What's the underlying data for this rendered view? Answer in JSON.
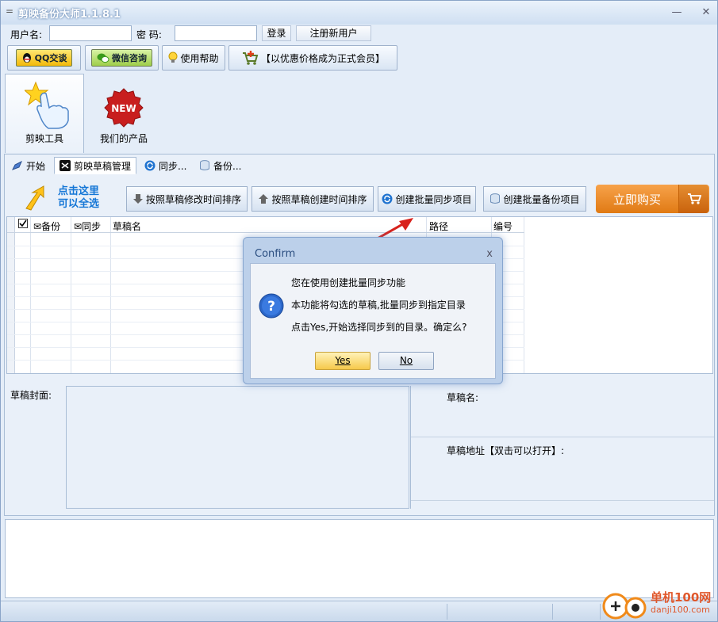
{
  "window": {
    "title": "剪映备份大师1.1.8.1",
    "sysmenu": "=",
    "minimize": "—",
    "close": "✕"
  },
  "login": {
    "username_label": "用户名:",
    "username_value": "",
    "password_label": "密  码:",
    "password_value": "",
    "login_button": "登录",
    "register_button": "注册新用户"
  },
  "toolbar": {
    "qq_label": "QQ交谈",
    "wechat_label": "微信咨询",
    "help_label": "使用帮助",
    "member_label": "【以优惠价格成为正式会员】"
  },
  "bigtabs": [
    {
      "label": "剪映工具",
      "icon": "star-hand-icon",
      "active": true
    },
    {
      "label": "我们的产品",
      "icon": "new-badge-icon",
      "badge": "NEW",
      "active": false
    }
  ],
  "subtabs": [
    {
      "label": "开始",
      "icon": "pen-icon",
      "active": false
    },
    {
      "label": "剪映草稿管理",
      "icon": "capcut-icon",
      "active": true
    },
    {
      "label": "同步...",
      "icon": "sync-icon",
      "active": false
    },
    {
      "label": "备份...",
      "icon": "database-icon",
      "active": false
    }
  ],
  "actions": {
    "select_all_line1": "点击这里",
    "select_all_line2": "可以全选",
    "sort_modified": "按照草稿修改时间排序",
    "sort_created": "按照草稿创建时间排序",
    "batch_sync": "创建批量同步项目",
    "batch_backup": "创建批量备份项目",
    "buy_now": "立即购买"
  },
  "grid": {
    "columns": [
      "备份",
      "同步",
      "草稿名",
      "路径",
      "编号"
    ],
    "rows": []
  },
  "details": {
    "cover_label": "草稿封面:",
    "name_label": "草稿名:",
    "path_label": "草稿地址【双击可以打开】:"
  },
  "dialog": {
    "title": "Confirm",
    "line1": "您在使用创建批量同步功能",
    "line2": "本功能将勾选的草稿,批量同步到指定目录",
    "line3": "点击Yes,开始选择同步到的目录。确定么?",
    "yes": "Yes",
    "no": "No",
    "close": "x"
  },
  "watermark": {
    "line1": "单机100网",
    "line2": "danji100.com"
  }
}
